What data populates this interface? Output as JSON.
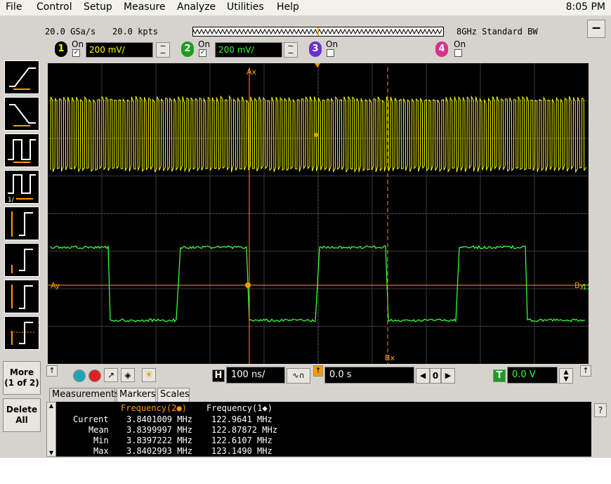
{
  "menu": {
    "items": [
      "File",
      "Control",
      "Setup",
      "Measure",
      "Analyze",
      "Utilities",
      "Help"
    ],
    "clock": "8:05 PM"
  },
  "acquisition": {
    "sample_rate": "20.0 GSa/s",
    "points": "20.0 kpts",
    "bandwidth": "8GHz Standard BW",
    "minimize_label": "–"
  },
  "channels": [
    {
      "number": "1",
      "state": "On",
      "scale": "200 mV/",
      "checked": true,
      "color": "#ffff00",
      "badge_bg": "#000000",
      "badge_fg": "#ffff00"
    },
    {
      "number": "2",
      "state": "On",
      "scale": "200 mV/",
      "checked": true,
      "color": "#33ff33",
      "badge_bg": "#1c9e1c",
      "badge_fg": "#ffffff"
    },
    {
      "number": "3",
      "state": "On",
      "checked": false,
      "color": "#8844ff",
      "badge_bg": "#6a2fcf",
      "badge_fg": "#ffffff"
    },
    {
      "number": "4",
      "state": "On",
      "checked": false,
      "color": "#ff44aa",
      "badge_bg": "#d6338a",
      "badge_fg": "#ffffff"
    }
  ],
  "scope": {
    "markers": {
      "ax": "Ax",
      "bx": "Bx",
      "ay": "Ay",
      "by": "By"
    },
    "ch1_ref": "1",
    "ch2_ref": "12"
  },
  "side_buttons": {
    "more": "More",
    "more_sub": "(1 of 2)",
    "delete": "Delete",
    "delete_sub": "All"
  },
  "horizontal": {
    "h_label": "H",
    "timebase": "100 ns/",
    "position": "0.0 s",
    "delay_value": "0",
    "t_label": "T",
    "trigger_level": "0.0 V"
  },
  "tabs": [
    "Measurements",
    "Markers",
    "Scales"
  ],
  "measurements": {
    "col1_header": "Frequency(2●)",
    "col2_header": "Frequency(1◆)",
    "rows": [
      {
        "label": "Current",
        "v1": "3.8401009 MHz",
        "v2": "122.9641 MHz"
      },
      {
        "label": "Mean",
        "v1": "3.8399997 MHz",
        "v2": "122.87872 MHz"
      },
      {
        "label": "Min",
        "v1": "3.8397222 MHz",
        "v2": "122.6107 MHz"
      },
      {
        "label": "Max",
        "v1": "3.8402993 MHz",
        "v2": "123.1490 MHz"
      }
    ],
    "help": "?"
  }
}
